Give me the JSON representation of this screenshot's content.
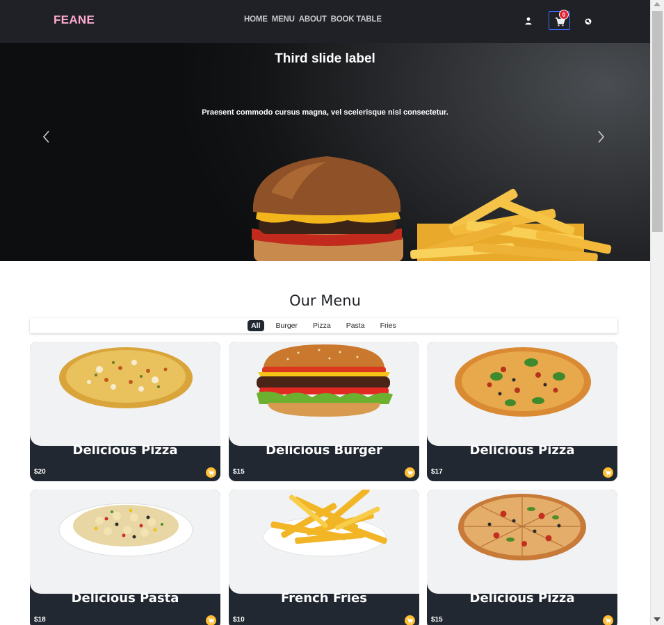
{
  "header": {
    "brand": "FEANE",
    "nav": [
      "HOME",
      "MENU",
      "ABOUT",
      "BOOK TABLE"
    ],
    "cart_count": "0",
    "icons": [
      "user-icon",
      "cart-icon",
      "search-icon"
    ]
  },
  "hero": {
    "title": "Third slide label",
    "text": "Praesent commodo cursus magna, vel scelerisque nisl consectetur."
  },
  "menu": {
    "title": "Our Menu",
    "filters": [
      "All",
      "Burger",
      "Pizza",
      "Pasta",
      "Fries"
    ],
    "active_filter": "All",
    "items": [
      {
        "title": "Delicious Pizza",
        "price": "$20",
        "image": "pizza"
      },
      {
        "title": "Delicious Burger",
        "price": "$15",
        "image": "burger"
      },
      {
        "title": "Delicious Pizza",
        "price": "$17",
        "image": "pizza-basil"
      },
      {
        "title": "Delicious Pasta",
        "price": "$18",
        "image": "pasta"
      },
      {
        "title": "French Fries",
        "price": "$10",
        "image": "fries"
      },
      {
        "title": "Delicious Pizza",
        "price": "$15",
        "image": "pizza-slices"
      }
    ]
  },
  "colors": {
    "header_bg": "#1f2126",
    "brand": "#ffabd0",
    "card_footer": "#222831",
    "accent": "#ffbe33",
    "badge": "#e01f2b"
  }
}
